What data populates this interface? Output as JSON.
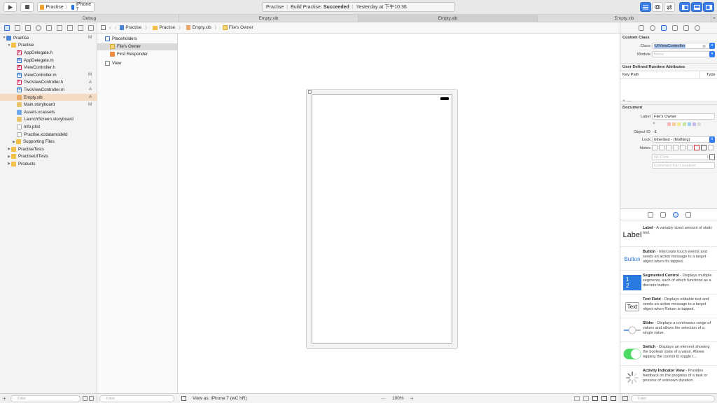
{
  "toolbar": {
    "run_icon": "play-icon",
    "stop_icon": "stop-icon",
    "scheme": "Practise",
    "device": "iPhone 7",
    "status_project": "Practise",
    "status_build_prefix": "Build Practise:",
    "status_build_result": "Succeeded",
    "status_time": "Yesterday at 下午10:36"
  },
  "tabs": [
    {
      "label": "Debug"
    },
    {
      "label": "Empty.xib"
    },
    {
      "label": "Empty.xib"
    },
    {
      "label": "Empty.xib"
    }
  ],
  "navigator": {
    "items": [
      {
        "label": "Practise",
        "badge": "M"
      },
      {
        "label": "Practise",
        "badge": ""
      },
      {
        "label": "AppDelegate.h",
        "badge": ""
      },
      {
        "label": "AppDelegate.m",
        "badge": ""
      },
      {
        "label": "ViewController.h",
        "badge": ""
      },
      {
        "label": "ViewController.m",
        "badge": "M"
      },
      {
        "label": "TwoViewController.h",
        "badge": "A"
      },
      {
        "label": "TwoViewController.m",
        "badge": "A"
      },
      {
        "label": "Empty.xib",
        "badge": "A"
      },
      {
        "label": "Main.storyboard",
        "badge": "M"
      },
      {
        "label": "Assets.xcassets",
        "badge": ""
      },
      {
        "label": "LaunchScreen.storyboard",
        "badge": ""
      },
      {
        "label": "Info.plist",
        "badge": ""
      },
      {
        "label": "Practise.xcdatamodeld",
        "badge": ""
      },
      {
        "label": "Supporting Files",
        "badge": ""
      },
      {
        "label": "PractiseTests",
        "badge": ""
      },
      {
        "label": "PractiseUITests",
        "badge": ""
      },
      {
        "label": "Products",
        "badge": ""
      }
    ],
    "filter_placeholder": "Filter"
  },
  "jumpbar": {
    "crumbs": [
      "Practise",
      "Practise",
      "Empty.xib",
      "File's Owner"
    ]
  },
  "outline": {
    "placeholders": "Placeholders",
    "files_owner": "File's Owner",
    "first_responder": "First Responder",
    "view": "View",
    "filter_placeholder": "Filter"
  },
  "bottombar": {
    "view_as": "View as: iPhone 7 (wC hR)",
    "zoom_minus": "—",
    "zoom": "100%",
    "zoom_plus": "+"
  },
  "inspector": {
    "custom_class_title": "Custom Class",
    "class_label": "Class",
    "class_value": "UIViewController",
    "module_label": "Module",
    "module_placeholder": "None",
    "runtime_title": "User Defined Runtime Attributes",
    "key_path": "Key Path",
    "type": "Type",
    "add_remove": "+ —",
    "document_title": "Document",
    "doc_label_label": "Label",
    "doc_label_value": "File's Owner",
    "swatch_x": "×",
    "object_id_label": "Object ID",
    "object_id_value": "-1",
    "lock_label": "Lock",
    "lock_value": "Inherited - (Nothing)",
    "notes_label": "Notes",
    "no_font": "No Font",
    "comment_placeholder": "Comment For Localizer",
    "swatch_colors": [
      "#f5b5b5",
      "#f7c99b",
      "#f5e58e",
      "#c8e6a0",
      "#9ccdf2",
      "#c9b7ec",
      "#dcdcdc"
    ]
  },
  "library": {
    "items": [
      {
        "icon_text": "Label",
        "name": "Label",
        "desc": " - A variably sized amount of static text."
      },
      {
        "icon_text": "Button",
        "name": "Button",
        "desc": " - Intercepts touch events and sends an action message to a target object when it's tapped."
      },
      {
        "icon_text": "1 2",
        "name": "Segmented Control",
        "desc": " - Displays multiple segments, each of which functions as a discrete button."
      },
      {
        "icon_text": "Text",
        "name": "Text Field",
        "desc": " - Displays editable text and sends an action message to a target object when Return is tapped."
      },
      {
        "icon_text": "",
        "name": "Slider",
        "desc": " - Displays a continuous range of values and allows the selection of a single value."
      },
      {
        "icon_text": "",
        "name": "Switch",
        "desc": " - Displays an element showing the boolean state of a value. Allows tapping the control to toggle t..."
      },
      {
        "icon_text": "",
        "name": "Activity Indicator View",
        "desc": " - Provides feedback on the progress of a task or process of unknown duration."
      }
    ],
    "filter_placeholder": "Filter"
  }
}
